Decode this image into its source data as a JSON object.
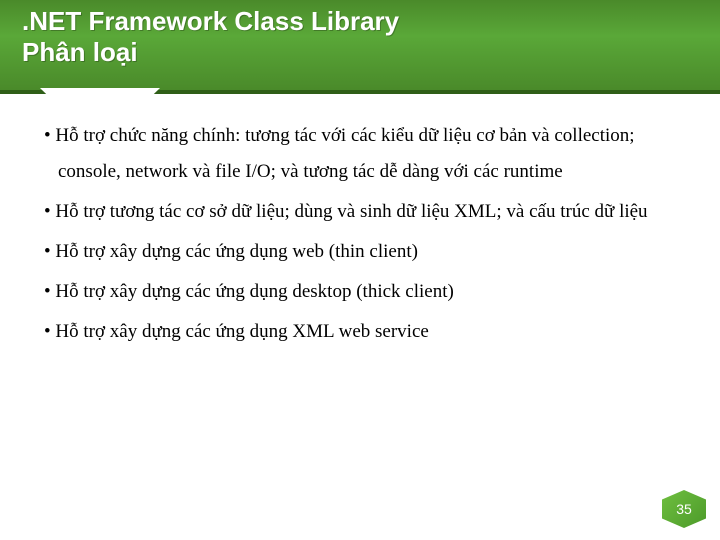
{
  "header": {
    "title_line1": ".NET Framework Class Library",
    "title_line2": "Phân loại"
  },
  "bullets": [
    "Hỗ trợ chức năng chính: tương tác với các kiểu dữ liệu cơ bản và collection; console, network và file I/O; và tương tác dễ dàng với các runtime",
    "Hỗ trợ  tương tác cơ sở dữ liệu; dùng và sinh dữ liệu XML; và cấu trúc dữ liệu",
    "Hỗ trợ xây dựng các ứng dụng web (thin client)",
    "Hỗ trợ xây dựng các ứng dụng desktop (thick client)",
    "Hỗ trợ xây dựng các ứng dụng XML web service"
  ],
  "page_number": "35"
}
